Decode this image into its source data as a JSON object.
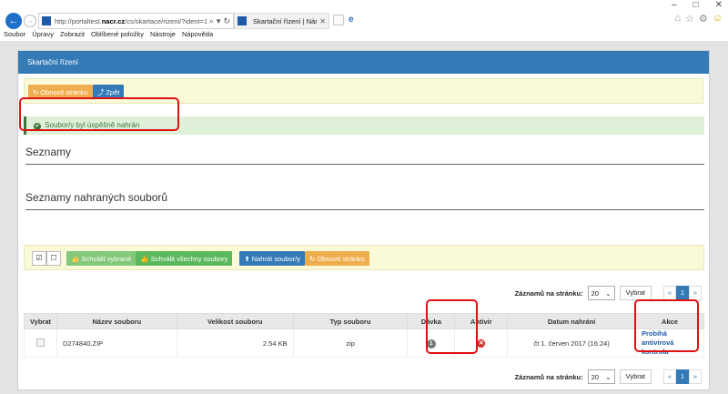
{
  "browser": {
    "window_controls": [
      "–",
      "□",
      "✕"
    ],
    "url_prefix": "http://portaltest.",
    "url_domain": "nacr.cz",
    "url_rest": "/cs/skartace/rizeni/?ident=1483&zpr",
    "tab_title": "Skartační řízení | Národní ar...",
    "menu": [
      "Soubor",
      "Úpravy",
      "Zobrazit",
      "Oblíbené položky",
      "Nástroje",
      "Nápověda"
    ]
  },
  "panel": {
    "title": "Skartační řízení",
    "refresh_label": "Obnovit stránku",
    "back_label": "Zpět"
  },
  "alert": {
    "message": "Soubor/y byl úspěšně nahrán"
  },
  "sections": {
    "lists_title": "Seznamy",
    "uploaded_title": "Seznamy nahraných souborů"
  },
  "toolbar": {
    "approve_selected": "Schválit vybrané",
    "approve_all": "Schválit všechny soubory",
    "upload": "Nahrát soubor/y",
    "refresh": "Obnovit stránku"
  },
  "pager": {
    "per_page_label": "Záznamů na stránku:",
    "per_page_value": "20",
    "select_button": "Vybrat",
    "prev": "«",
    "current": "1",
    "next": "»"
  },
  "table": {
    "headers": [
      "Vybrat",
      "Název souboru",
      "Velikost souboru",
      "Typ souboru",
      "Dávka",
      "Antivir",
      "Datum nahrání",
      "Akce"
    ],
    "rows": [
      {
        "name": "D274840.ZIP",
        "size": "2.54 KB",
        "type": "zip",
        "batch": "1",
        "date": "čt 1. červen 2017 (16:24)",
        "action": [
          "Probíhá",
          "antivirová",
          "kontrola"
        ]
      }
    ]
  },
  "colors": {
    "primary": "#337ab7",
    "warning": "#f0ad4e",
    "success": "#5cb85c",
    "danger": "#c9302c",
    "annotation": "#e01010"
  }
}
